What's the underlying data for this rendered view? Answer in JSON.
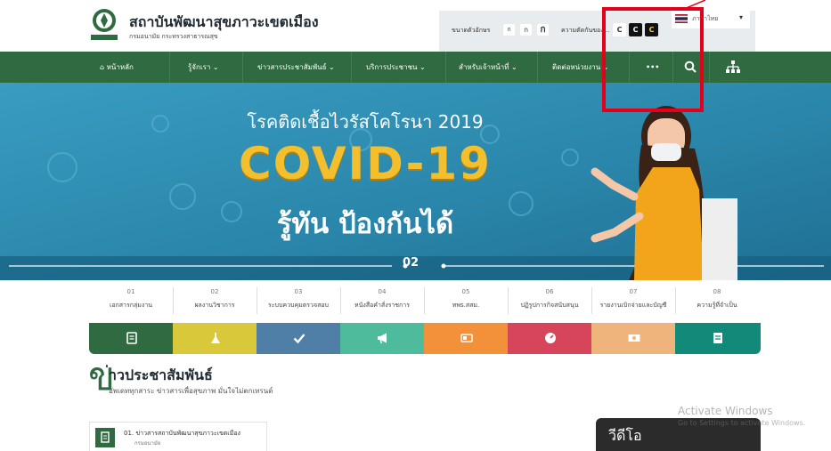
{
  "header": {
    "title": "สถาบันพัฒนาสุขภาวะเขตเมือง",
    "subtitle": "กรมอนามัย กระทรวงสาธารณสุข",
    "logo_icon": "institute-logo-icon",
    "font_size_label": "ขนาดตัวอักษร",
    "font_sizes": [
      "ก",
      "ก",
      "ก"
    ],
    "contrast_label": "ความตัดกันของ...",
    "contrast_options": [
      "C",
      "C",
      "C"
    ],
    "language": "ภาษาไทย",
    "language_flag_icon": "thai-flag-icon"
  },
  "nav": {
    "items": [
      {
        "label": "หน้าหลัก",
        "icon": "home-icon"
      },
      {
        "label": "รู้จักเรา"
      },
      {
        "label": "ข่าวสารประชาสัมพันธ์"
      },
      {
        "label": "บริการประชาชน"
      },
      {
        "label": "สำหรับเจ้าหน้าที่"
      },
      {
        "label": "ติดต่อหน่วยงาน"
      }
    ],
    "more_label": "•••",
    "search_icon": "search-icon",
    "sitemap_icon": "sitemap-icon",
    "caret": "⌄"
  },
  "banner": {
    "headline": "โรคติดเชื้อไวรัสโคโรนา 2019",
    "big_text": "COVID-19",
    "tagline": "รู้ทัน ป้องกันได้",
    "slide_number": "02"
  },
  "categories": [
    {
      "num": "01",
      "label": "เอกสารกลุ่มงาน"
    },
    {
      "num": "02",
      "label": "ผลงานวิชาการ"
    },
    {
      "num": "03",
      "label": "ระบบควบคุมตรวจสอบ"
    },
    {
      "num": "04",
      "label": "หนังสือคำสั่งราชการ"
    },
    {
      "num": "05",
      "label": "ทพs.สสม."
    },
    {
      "num": "06",
      "label": "ปฏิรูปการกิจสนับสนุน"
    },
    {
      "num": "07",
      "label": "รายงานเบิกจ่ายและบัญชี"
    },
    {
      "num": "08",
      "label": "ความรู้ที่จำเป็น"
    }
  ],
  "tiles": [
    {
      "color": "#2f6a40",
      "icon": "document-icon"
    },
    {
      "color": "#d9c93a",
      "icon": "flask-icon"
    },
    {
      "color": "#4f7ea6",
      "icon": "check-icon"
    },
    {
      "color": "#4dbb9c",
      "icon": "megaphone-icon"
    },
    {
      "color": "#f3913a",
      "icon": "newspaper-icon"
    },
    {
      "color": "#d7455a",
      "icon": "gauge-icon"
    },
    {
      "color": "#efb47c",
      "icon": "money-icon"
    },
    {
      "color": "#128a7a",
      "icon": "book-icon"
    }
  ],
  "news": {
    "mark": "ข",
    "title": "่าวประชาสัมพันธ์",
    "subtitle": "อัพเดททุกสาระ ข่าวสารเพื่อสุขภาพ มั่นใจไม่ตกเทรนด์",
    "card_title": "01. ข่าวสารสถาบันพัฒนาสุขภาวะเขตเมือง",
    "card_sub": "กรมอนามัย",
    "card_icon": "document-icon"
  },
  "video": {
    "label": "วีดีโอ"
  },
  "watermark": {
    "title": "Activate Windows",
    "subtitle": "Go to Settings to activate Windows."
  },
  "colors": {
    "nav_green": "#2f6a40",
    "banner_blue": "#2a8aad",
    "highlight_red": "#e4001b",
    "covid_yellow": "#f4bf2c"
  }
}
